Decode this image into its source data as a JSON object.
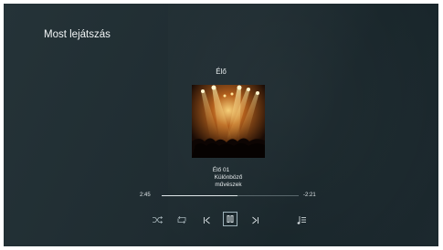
{
  "app": {
    "page_title": "Most lejátszás"
  },
  "now_playing": {
    "album": "Élő",
    "track": "Élő 01",
    "artist": "Különböző művészek",
    "elapsed": "2:45",
    "remaining": "-2:21",
    "progress_fraction": 0.55
  },
  "controls": {
    "shuffle_icon": "shuffle-icon",
    "repeat_icon": "repeat-icon",
    "previous_icon": "previous-icon",
    "play_pause_icon": "pause-icon",
    "next_icon": "next-icon",
    "queue_icon": "queue-icon"
  },
  "colors": {
    "background": "#1f2c31",
    "accent": "#9fb3bb",
    "text": "#e9eef0"
  }
}
